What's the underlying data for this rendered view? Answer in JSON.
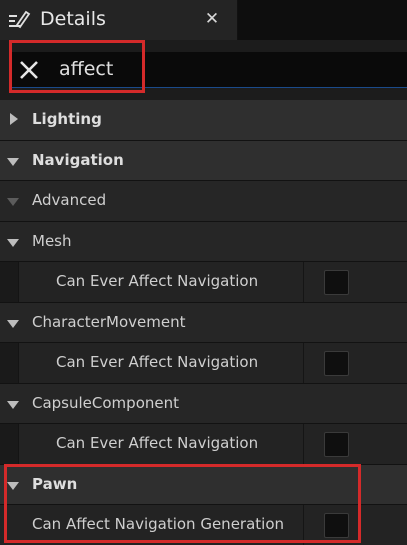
{
  "panel": {
    "title": "Details",
    "close_label": "✕",
    "icon": "details-pencil-icon"
  },
  "search": {
    "value": "affect",
    "clear_icon": "close-icon"
  },
  "highlight_color": "#d42a2a",
  "rows": [
    {
      "type": "category",
      "label": "Lighting",
      "expanded": false
    },
    {
      "type": "category",
      "label": "Navigation",
      "expanded": true
    },
    {
      "type": "subcategory",
      "label": "Advanced",
      "expanded": true
    },
    {
      "type": "subcategory",
      "label": "Mesh",
      "expanded": true
    },
    {
      "type": "property",
      "label": "Can Ever Affect Navigation",
      "checked": false
    },
    {
      "type": "subcategory",
      "label": "CharacterMovement",
      "expanded": true
    },
    {
      "type": "property",
      "label": "Can Ever Affect Navigation",
      "checked": false
    },
    {
      "type": "subcategory",
      "label": "CapsuleComponent",
      "expanded": true
    },
    {
      "type": "property",
      "label": "Can Ever Affect Navigation",
      "checked": false
    },
    {
      "type": "category",
      "label": "Pawn",
      "expanded": true
    },
    {
      "type": "property",
      "label": "Can Affect Navigation Generation",
      "checked": false
    }
  ]
}
